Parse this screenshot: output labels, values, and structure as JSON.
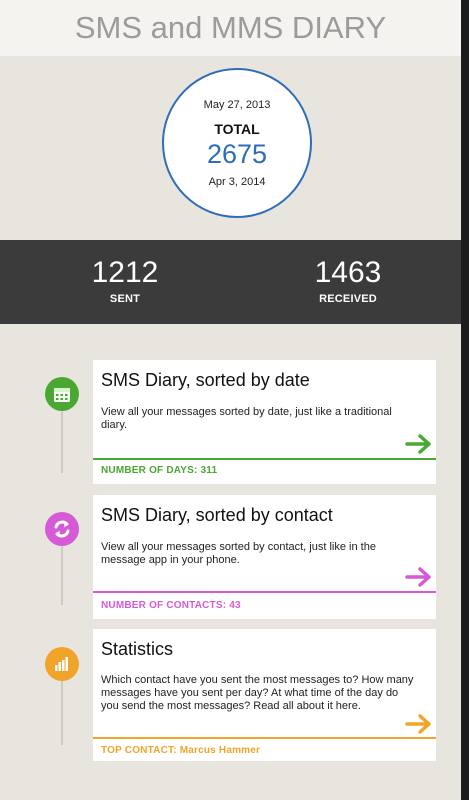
{
  "app": {
    "title": "SMS and MMS DIARY"
  },
  "summary": {
    "start_date": "May 27, 2013",
    "total_label": "TOTAL",
    "total_value": "2675",
    "end_date": "Apr 3, 2014",
    "accent": "#2e6db7"
  },
  "stats": {
    "sent_value": "1212",
    "sent_label": "SENT",
    "received_value": "1463",
    "received_label": "RECEIVED"
  },
  "cards": [
    {
      "title": "SMS Diary, sorted by date",
      "description": "View all your messages sorted by date, just like a traditional diary.",
      "footer": "NUMBER OF DAYS: 311",
      "color": "#4aa832",
      "icon": "calendar-icon"
    },
    {
      "title": "SMS Diary, sorted by contact",
      "description": "View all your messages sorted by contact, just like in the message app in your phone.",
      "footer": "NUMBER OF CONTACTS: 43",
      "color": "#d65ad6",
      "icon": "refresh-arrows-icon"
    },
    {
      "title": "Statistics",
      "description": "Which contact have you sent the most messages to? How many messages have you sent per day? At what time of the day do you send the most messages? Read all about it here.",
      "footer": "TOP CONTACT: Marcus Hammer",
      "color": "#f0a52a",
      "icon": "bar-chart-icon"
    }
  ]
}
